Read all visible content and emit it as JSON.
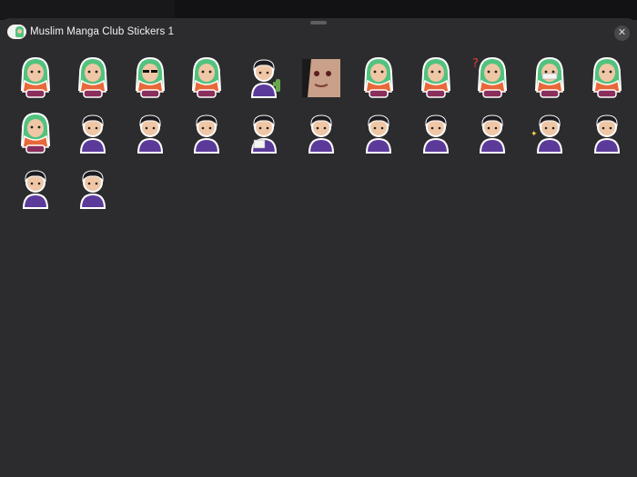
{
  "header": {
    "title": "Muslim Manga Club Stickers 1",
    "close_label": "✕"
  },
  "colors": {
    "sheet_background": "#2c2c2e",
    "hijab_green": "#52c27e",
    "scarf_orange": "#e8683a",
    "robe_purple": "#5c3a9a",
    "hair_black": "#1c1c22",
    "skin": "#f0c7a6"
  },
  "stickers": [
    {
      "character": "girl",
      "icon": "girl-eyes-closed-sticker"
    },
    {
      "character": "girl",
      "icon": "girl-scribble-sticker"
    },
    {
      "character": "girl",
      "icon": "girl-sunglasses-sticker"
    },
    {
      "character": "girl",
      "icon": "girl-side-glance-sticker"
    },
    {
      "character": "boy",
      "icon": "boy-with-cactus-sticker"
    },
    {
      "character": "girl",
      "icon": "girl-closeup-sticker"
    },
    {
      "character": "girl",
      "icon": "girl-excited-sticker"
    },
    {
      "character": "girl",
      "icon": "girl-smiling-sticker"
    },
    {
      "character": "girl",
      "icon": "girl-question-mark-sticker"
    },
    {
      "character": "girl",
      "icon": "girl-masked-sticker"
    },
    {
      "character": "girl",
      "icon": "girl-sighing-sticker"
    },
    {
      "character": "girl",
      "icon": "girl-crying-sticker"
    },
    {
      "character": "boy",
      "icon": "boy-smiling-sticker"
    },
    {
      "character": "boy",
      "icon": "boy-thinking-sticker"
    },
    {
      "character": "boy",
      "icon": "boy-angry-sticker"
    },
    {
      "character": "boy",
      "icon": "boy-reading-sticker"
    },
    {
      "character": "boy",
      "icon": "boy-neutral-sticker"
    },
    {
      "character": "boy",
      "icon": "boy-shocked-sticker"
    },
    {
      "character": "boy",
      "icon": "boy-facepalm-sticker"
    },
    {
      "character": "boy",
      "icon": "boy-sighing-sticker"
    },
    {
      "character": "boy",
      "icon": "boy-sparkle-sticker"
    },
    {
      "character": "boy",
      "icon": "boy-sleepy-sticker"
    },
    {
      "character": "boy",
      "icon": "boy-pointing-sticker"
    },
    {
      "character": "boy",
      "icon": "boy-surprised-sticker"
    }
  ]
}
